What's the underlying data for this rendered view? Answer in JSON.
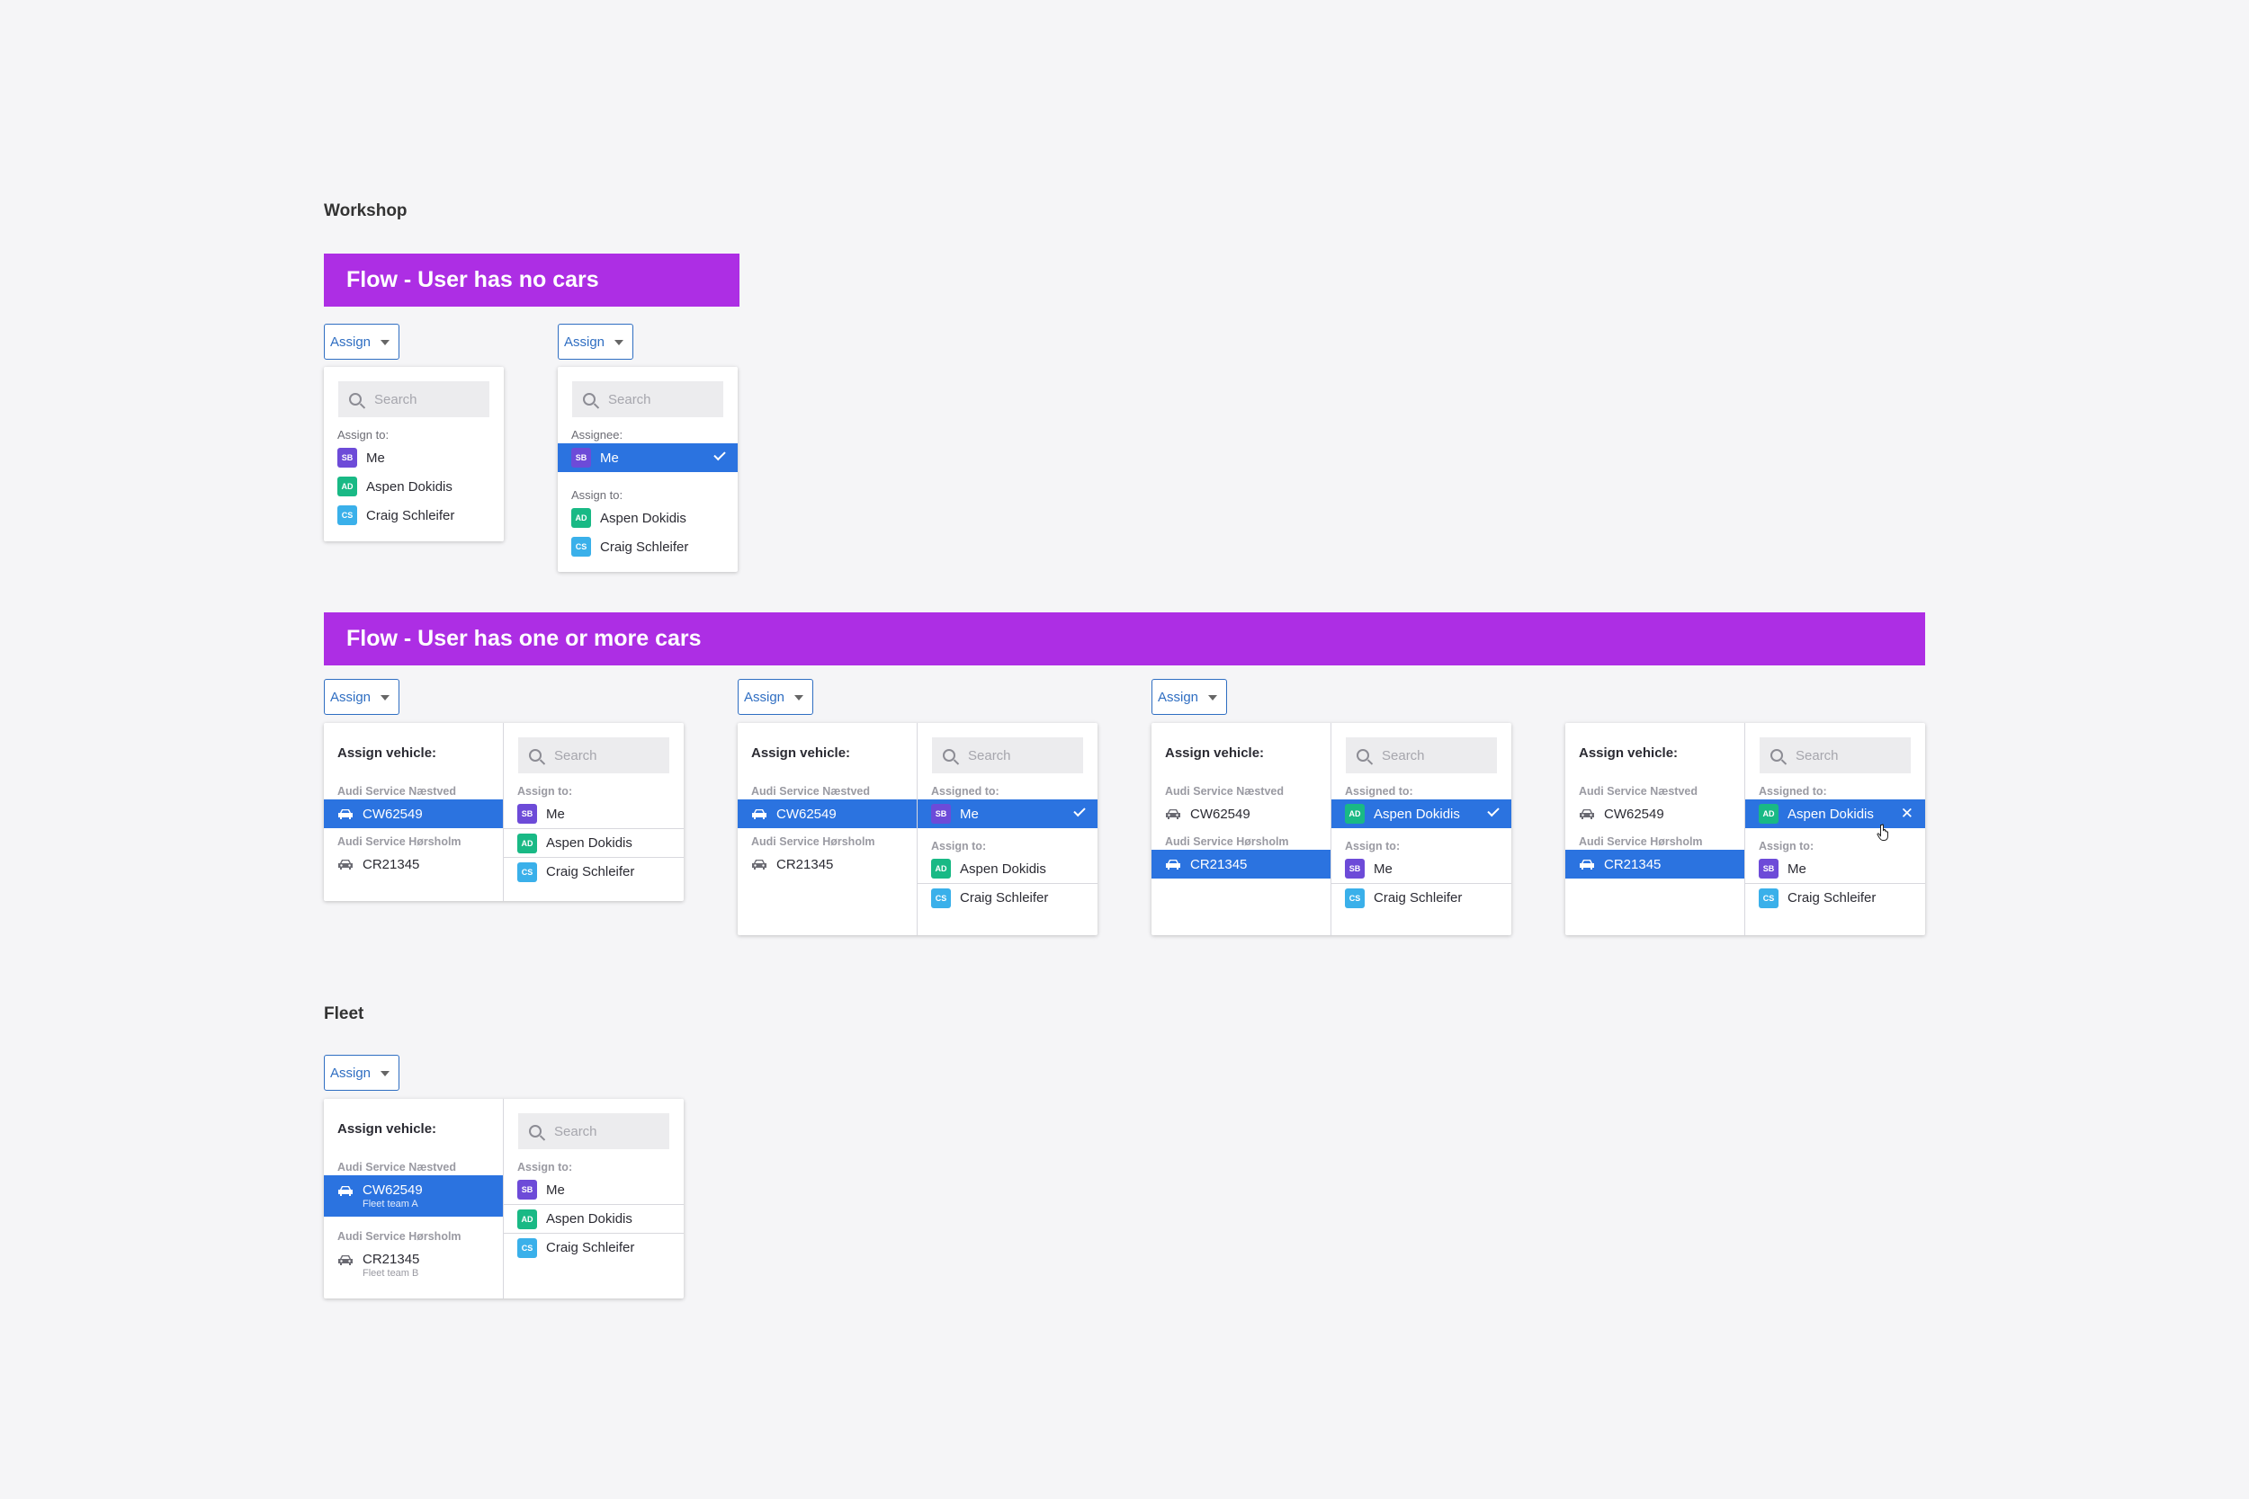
{
  "workshop": {
    "title": "Workshop",
    "flow_no_cars": {
      "title": "Flow - User has no cars",
      "assign_label": "Assign",
      "search_placeholder": "Search",
      "state1": {
        "assign_to_label": "Assign to:",
        "people": [
          {
            "initials": "SB",
            "name": "Me"
          },
          {
            "initials": "AD",
            "name": "Aspen Dokidis"
          },
          {
            "initials": "CS",
            "name": "Craig Schleifer"
          }
        ]
      },
      "state2": {
        "assignee_label": "Assignee:",
        "assignee": {
          "initials": "SB",
          "name": "Me"
        },
        "assign_to_label": "Assign to:",
        "people": [
          {
            "initials": "AD",
            "name": "Aspen Dokidis"
          },
          {
            "initials": "CS",
            "name": "Craig Schleifer"
          }
        ]
      }
    },
    "flow_cars": {
      "title": "Flow - User has one or more cars",
      "assign_label": "Assign",
      "assign_vehicle_label": "Assign vehicle:",
      "search_placeholder": "Search",
      "groups": [
        "Audi Service Næstved",
        "Audi Service Hørsholm"
      ],
      "cars": [
        "CW62549",
        "CR21345"
      ],
      "assign_to_label": "Assign to:",
      "assigned_to_label": "Assigned to:",
      "people": [
        {
          "initials": "SB",
          "name": "Me"
        },
        {
          "initials": "AD",
          "name": "Aspen Dokidis"
        },
        {
          "initials": "CS",
          "name": "Craig Schleifer"
        }
      ]
    }
  },
  "fleet": {
    "title": "Fleet",
    "assign_label": "Assign",
    "assign_vehicle_label": "Assign vehicle:",
    "search_placeholder": "Search",
    "groups": [
      "Audi Service Næstved",
      "Audi Service Hørsholm"
    ],
    "cars": [
      {
        "plate": "CW62549",
        "team": "Fleet team A"
      },
      {
        "plate": "CR21345",
        "team": "Fleet team B"
      }
    ],
    "assign_to_label": "Assign to:",
    "people": [
      {
        "initials": "SB",
        "name": "Me"
      },
      {
        "initials": "AD",
        "name": "Aspen Dokidis"
      },
      {
        "initials": "CS",
        "name": "Craig Schleifer"
      }
    ]
  },
  "colors": {
    "banner": "#ad2ee4",
    "selected": "#2b73e0",
    "button": "#2f6ec2"
  }
}
